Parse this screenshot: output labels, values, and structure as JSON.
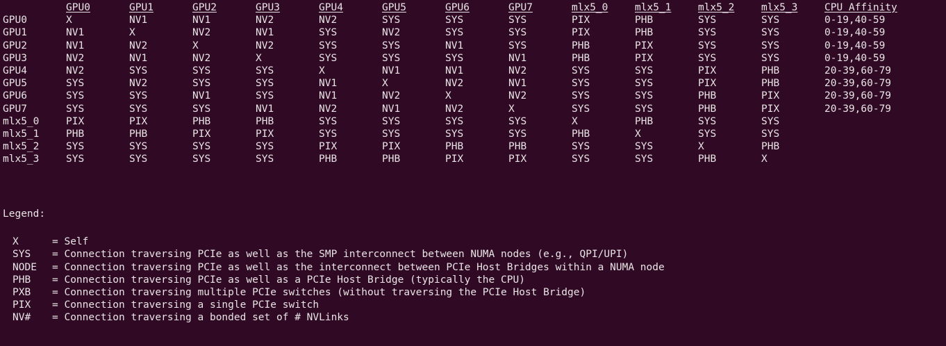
{
  "header": [
    "",
    "GPU0",
    "GPU1",
    "GPU2",
    "GPU3",
    "GPU4",
    "GPU5",
    "GPU6",
    "GPU7",
    "mlx5_0",
    "mlx5_1",
    "mlx5_2",
    "mlx5_3",
    "CPU Affinity"
  ],
  "rows": [
    [
      "GPU0",
      "X",
      "NV1",
      "NV1",
      "NV2",
      "NV2",
      "SYS",
      "SYS",
      "SYS",
      "PIX",
      "PHB",
      "SYS",
      "SYS",
      "0-19,40-59"
    ],
    [
      "GPU1",
      "NV1",
      "X",
      "NV2",
      "NV1",
      "SYS",
      "NV2",
      "SYS",
      "SYS",
      "PIX",
      "PHB",
      "SYS",
      "SYS",
      "0-19,40-59"
    ],
    [
      "GPU2",
      "NV1",
      "NV2",
      "X",
      "NV2",
      "SYS",
      "SYS",
      "NV1",
      "SYS",
      "PHB",
      "PIX",
      "SYS",
      "SYS",
      "0-19,40-59"
    ],
    [
      "GPU3",
      "NV2",
      "NV1",
      "NV2",
      "X",
      "SYS",
      "SYS",
      "SYS",
      "NV1",
      "PHB",
      "PIX",
      "SYS",
      "SYS",
      "0-19,40-59"
    ],
    [
      "GPU4",
      "NV2",
      "SYS",
      "SYS",
      "SYS",
      "X",
      "NV1",
      "NV1",
      "NV2",
      "SYS",
      "SYS",
      "PIX",
      "PHB",
      "20-39,60-79"
    ],
    [
      "GPU5",
      "SYS",
      "NV2",
      "SYS",
      "SYS",
      "NV1",
      "X",
      "NV2",
      "NV1",
      "SYS",
      "SYS",
      "PIX",
      "PHB",
      "20-39,60-79"
    ],
    [
      "GPU6",
      "SYS",
      "SYS",
      "NV1",
      "SYS",
      "NV1",
      "NV2",
      "X",
      "NV2",
      "SYS",
      "SYS",
      "PHB",
      "PIX",
      "20-39,60-79"
    ],
    [
      "GPU7",
      "SYS",
      "SYS",
      "SYS",
      "NV1",
      "NV2",
      "NV1",
      "NV2",
      "X",
      "SYS",
      "SYS",
      "PHB",
      "PIX",
      "20-39,60-79"
    ],
    [
      "mlx5_0",
      "PIX",
      "PIX",
      "PHB",
      "PHB",
      "SYS",
      "SYS",
      "SYS",
      "SYS",
      "X",
      "PHB",
      "SYS",
      "SYS",
      ""
    ],
    [
      "mlx5_1",
      "PHB",
      "PHB",
      "PIX",
      "PIX",
      "SYS",
      "SYS",
      "SYS",
      "SYS",
      "PHB",
      "X",
      "SYS",
      "SYS",
      ""
    ],
    [
      "mlx5_2",
      "SYS",
      "SYS",
      "SYS",
      "SYS",
      "PIX",
      "PIX",
      "PHB",
      "PHB",
      "SYS",
      "SYS",
      "X",
      "PHB",
      ""
    ],
    [
      "mlx5_3",
      "SYS",
      "SYS",
      "SYS",
      "SYS",
      "PHB",
      "PHB",
      "PIX",
      "PIX",
      "SYS",
      "SYS",
      "PHB",
      "X",
      ""
    ]
  ],
  "legend": {
    "title": "Legend:",
    "items": [
      {
        "key": "X",
        "desc": "= Self"
      },
      {
        "key": "SYS",
        "desc": "= Connection traversing PCIe as well as the SMP interconnect between NUMA nodes (e.g., QPI/UPI)"
      },
      {
        "key": "NODE",
        "desc": "= Connection traversing PCIe as well as the interconnect between PCIe Host Bridges within a NUMA node"
      },
      {
        "key": "PHB",
        "desc": "= Connection traversing PCIe as well as a PCIe Host Bridge (typically the CPU)"
      },
      {
        "key": "PXB",
        "desc": "= Connection traversing multiple PCIe switches (without traversing the PCIe Host Bridge)"
      },
      {
        "key": "PIX",
        "desc": "= Connection traversing a single PCIe switch"
      },
      {
        "key": "NV#",
        "desc": "= Connection traversing a bonded set of # NVLinks"
      }
    ]
  },
  "colors": {
    "background": "#300a24",
    "foreground": "#e9e4e6"
  }
}
